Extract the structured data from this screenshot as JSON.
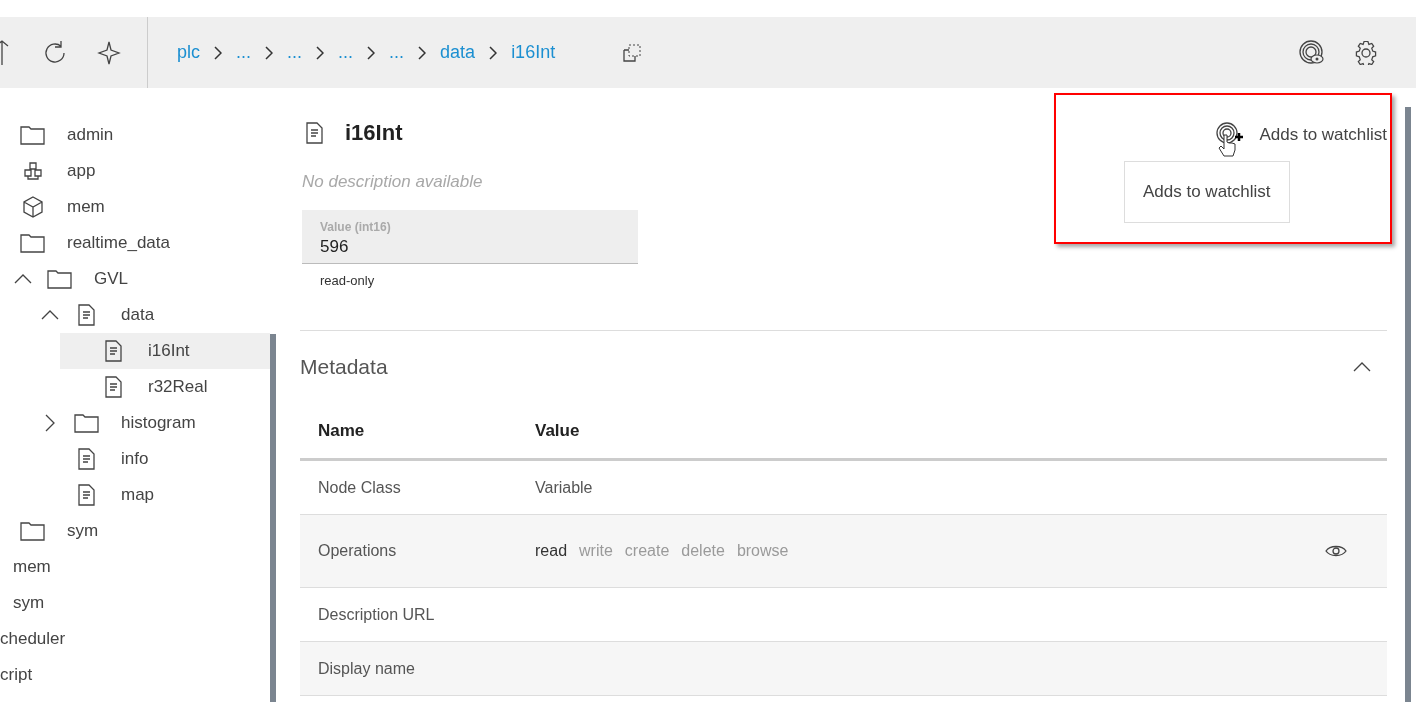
{
  "toolbar": {
    "breadcrumbs": [
      {
        "label": "plc"
      },
      {
        "label": "..."
      },
      {
        "label": "..."
      },
      {
        "label": "..."
      },
      {
        "label": "..."
      },
      {
        "label": "data"
      },
      {
        "label": "i16Int"
      }
    ]
  },
  "tree": [
    {
      "label": "admin",
      "kind": "folder",
      "selected": false
    },
    {
      "label": "app",
      "kind": "apps",
      "selected": false
    },
    {
      "label": "mem",
      "kind": "box",
      "selected": false
    },
    {
      "label": "realtime_data",
      "kind": "folder",
      "selected": false,
      "children": [
        {
          "label": "GVL",
          "kind": "folder",
          "selected": false,
          "expanded": true,
          "children": [
            {
              "label": "data",
              "kind": "file",
              "selected": false,
              "expanded": true,
              "children": [
                {
                  "label": "i16Int",
                  "kind": "file",
                  "selected": true
                },
                {
                  "label": "r32Real",
                  "kind": "file",
                  "selected": false
                }
              ]
            },
            {
              "label": "histogram",
              "kind": "folder",
              "selected": false,
              "expanded": false
            },
            {
              "label": "info",
              "kind": "file",
              "selected": false
            },
            {
              "label": "map",
              "kind": "file",
              "selected": false
            }
          ]
        }
      ]
    },
    {
      "label": "sym",
      "kind": "folder",
      "selected": false
    }
  ],
  "sibling_items": [
    {
      "label": "mem"
    },
    {
      "label": "sym"
    }
  ],
  "outer_items": [
    {
      "label": "cheduler"
    },
    {
      "label": "cript"
    }
  ],
  "node": {
    "title": "i16Int",
    "description": "No description available",
    "value_field": {
      "label": "Value (int16)",
      "value": "596",
      "helper": "read-only"
    }
  },
  "metadata": {
    "title": "Metadata",
    "expanded": true,
    "columns": [
      "Name",
      "Value"
    ],
    "rows": [
      {
        "name": "Node Class",
        "value": "Variable"
      },
      {
        "name": "Operations",
        "operations": [
          {
            "label": "read",
            "enabled": true
          },
          {
            "label": "write",
            "enabled": false
          },
          {
            "label": "create",
            "enabled": false
          },
          {
            "label": "delete",
            "enabled": false
          },
          {
            "label": "browse",
            "enabled": false
          }
        ]
      },
      {
        "name": "Description URL",
        "value": ""
      },
      {
        "name": "Display name",
        "value": ""
      }
    ]
  },
  "callout": {
    "action_label": "Adds to watchlist",
    "tooltip": "Adds to watchlist"
  }
}
